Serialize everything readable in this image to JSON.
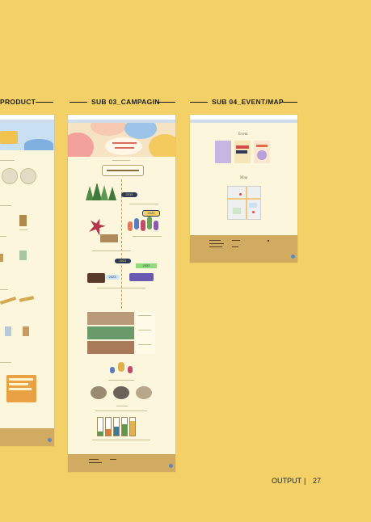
{
  "labels": {
    "product": "PRODUCT",
    "campaign": "SUB 03_CAMPAGIN",
    "event_map": "SUB 04_EVENT/MAP"
  },
  "campaign": {
    "years": [
      "2019",
      "2020",
      "2021",
      "2022",
      "2023"
    ],
    "tags": [
      "2019",
      "2020",
      "2021",
      "2022",
      "2023"
    ]
  },
  "event_page": {
    "event_heading": "Event",
    "map_heading": "Map"
  },
  "footer": {
    "section": "OUTPUT",
    "separator": "|",
    "page_number": "27"
  },
  "colors": {
    "background": "#f3d166",
    "page": "#fbf6dc",
    "footer": "#d2ab62"
  }
}
